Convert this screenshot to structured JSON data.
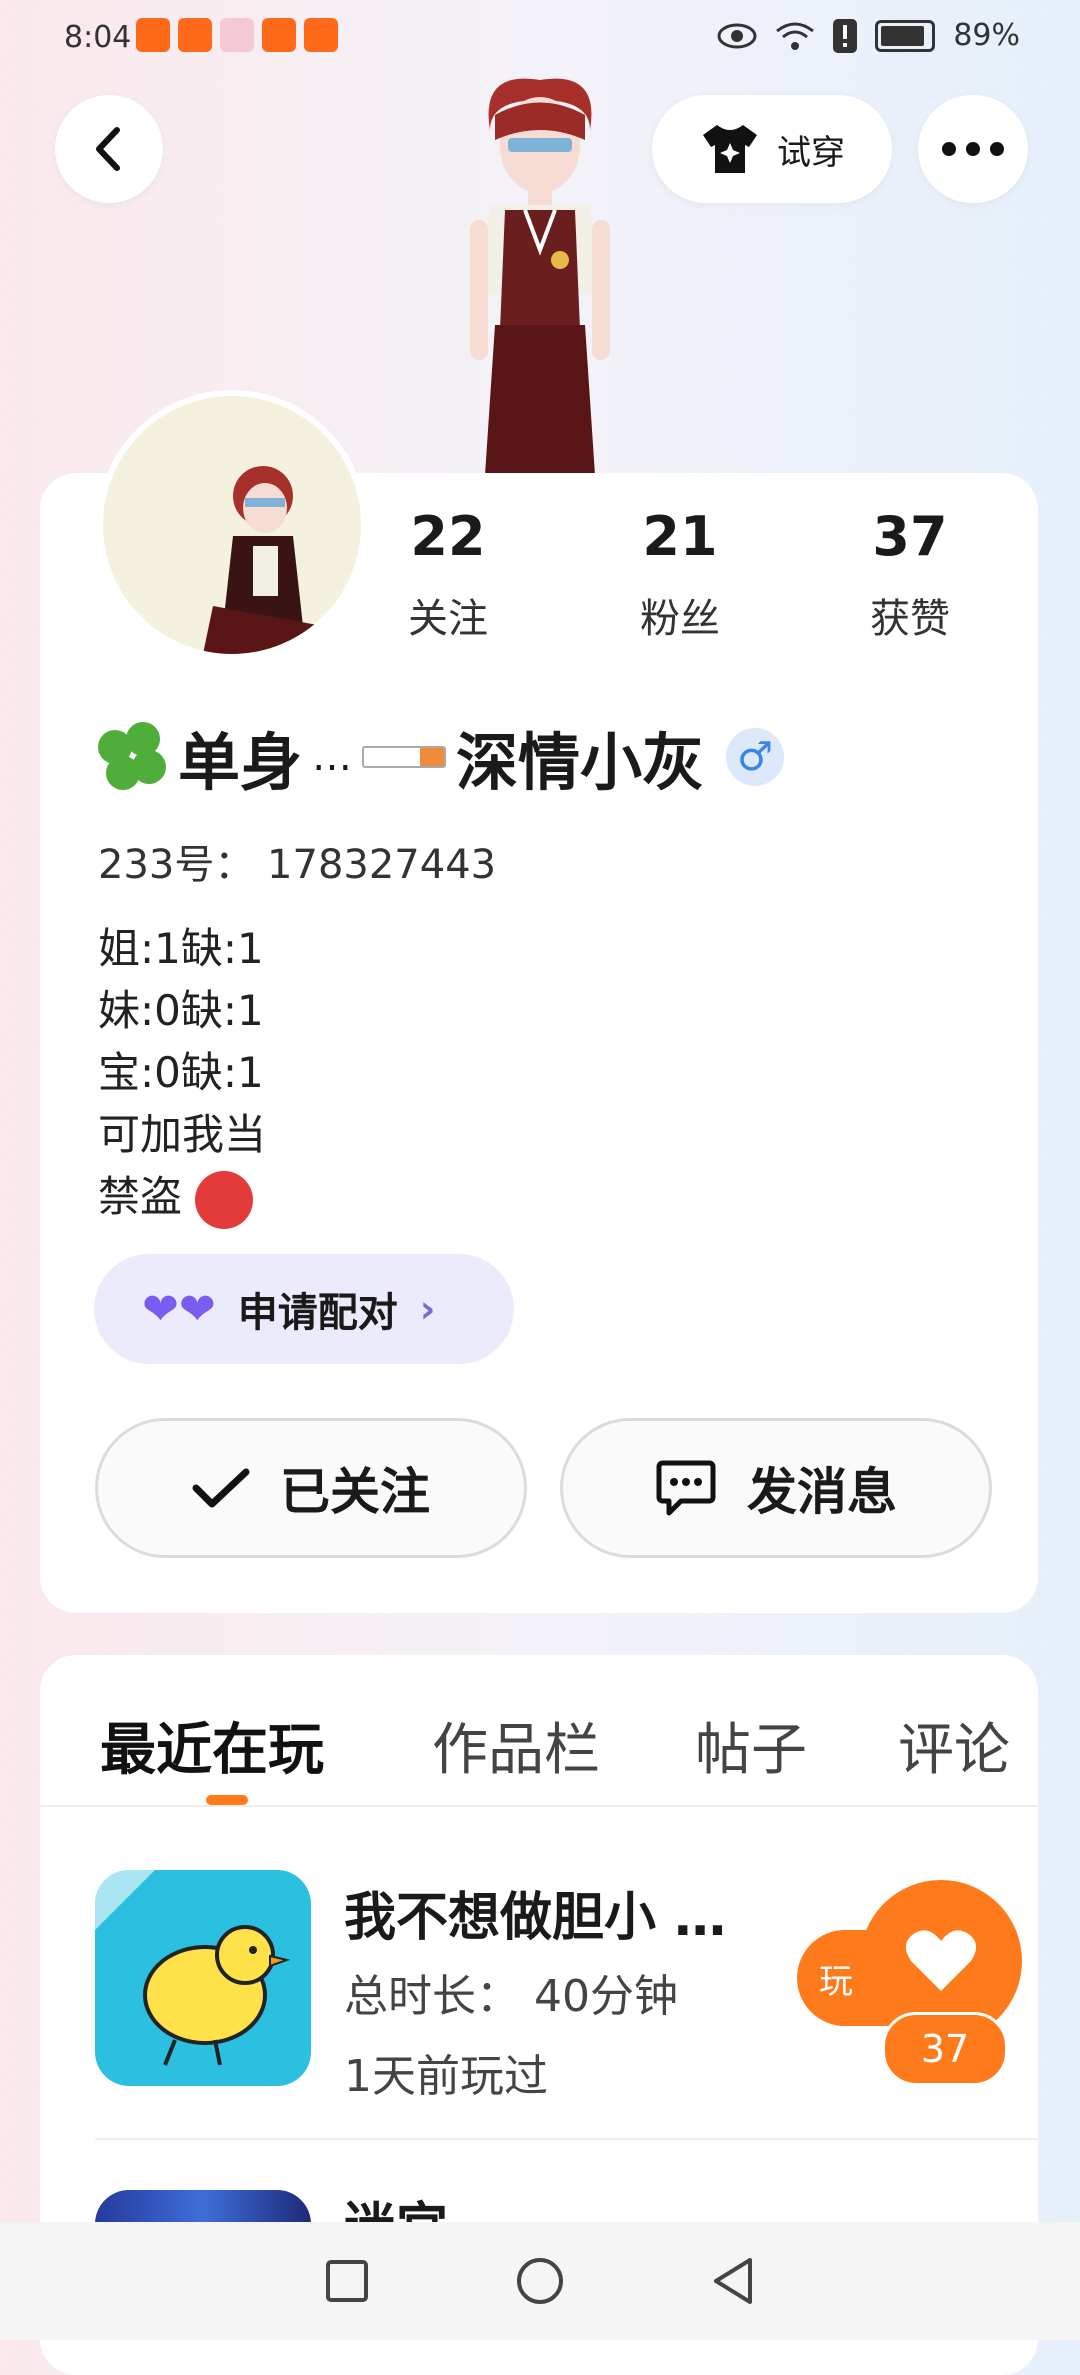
{
  "status_bar": {
    "time": "8:04",
    "battery": "89%",
    "battery_fraction": 0.89
  },
  "top_bar": {
    "try_on_label": "试穿"
  },
  "profile": {
    "stats": [
      {
        "value": "22",
        "label": "关注"
      },
      {
        "value": "21",
        "label": "粉丝"
      },
      {
        "value": "37",
        "label": "获赞"
      }
    ],
    "nickname_part1": "单身",
    "nickname_dots": "…",
    "nickname_part2": "深情小灰",
    "gender": "♂",
    "id_line": "233号： 178327443",
    "bio_lines": [
      "姐:1缺:1",
      "妹:0缺:1",
      "宝:0缺:1",
      "可加我当"
    ],
    "bio_last": "禁盗",
    "pair_label": "申请配对",
    "follow_label": "已关注",
    "message_label": "发消息"
  },
  "tabs": [
    {
      "label": "最近在玩",
      "active": true
    },
    {
      "label": "作品栏",
      "active": false
    },
    {
      "label": "帖子",
      "active": false
    },
    {
      "label": "评论",
      "active": false
    }
  ],
  "games": [
    {
      "title": "我不想做胆小 …",
      "duration": "总时长： 40分钟",
      "last_played": "1天前玩过",
      "play_label": "玩"
    },
    {
      "title": "迷宫"
    }
  ],
  "like_count": "37",
  "colors": {
    "accent": "#ff7a1a",
    "pair_bg": "#ecebfb",
    "pair_heart": "#7a5cf0"
  }
}
